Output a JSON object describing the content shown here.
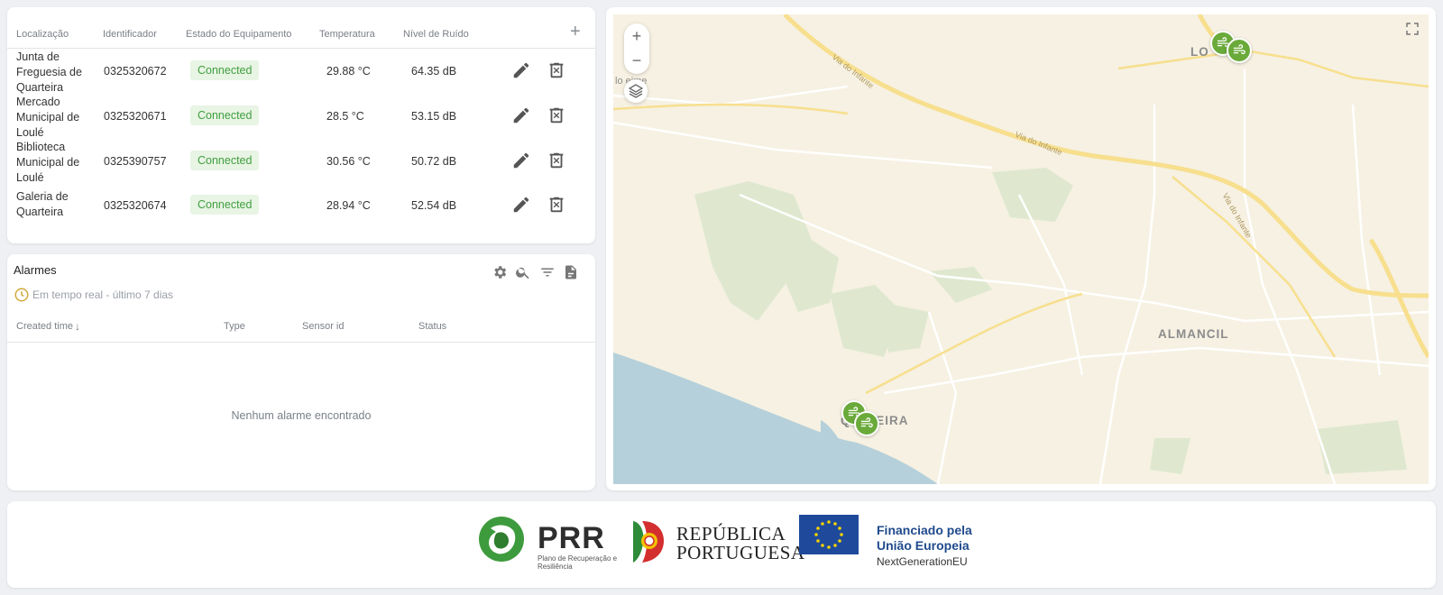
{
  "devices": {
    "columns": [
      "Localização",
      "Identificador",
      "Estado do Equipamento",
      "Temperatura",
      "Nível de Ruído"
    ],
    "add_label": "+",
    "rows": [
      {
        "location": "Junta de Freguesia de Quarteira",
        "id": "0325320672",
        "status": "Connected",
        "temperature": "29.88 °C",
        "noise": "64.35 dB"
      },
      {
        "location": "Mercado Municipal de Loulé",
        "id": "0325320671",
        "status": "Connected",
        "temperature": "28.5 °C",
        "noise": "53.15 dB"
      },
      {
        "location": "Biblioteca Municipal de Loulé",
        "id": "0325390757",
        "status": "Connected",
        "temperature": "30.56 °C",
        "noise": "50.72 dB"
      },
      {
        "location": "Galeria de Quarteira",
        "id": "0325320674",
        "status": "Connected",
        "temperature": "28.94 °C",
        "noise": "52.54 dB"
      }
    ],
    "icons": {
      "edit": "pencil-icon",
      "delete": "trash-icon"
    }
  },
  "alarms": {
    "title": "Alarmes",
    "timewindow": "Em tempo real - último 7 dias",
    "columns": [
      "Created time",
      "Type",
      "Sensor id",
      "Status"
    ],
    "empty_message": "Nenhum alarme encontrado",
    "toolbar_icons": [
      "gear-icon",
      "search-icon",
      "filter-icon",
      "export-icon"
    ]
  },
  "map": {
    "zoom_in": "+",
    "zoom_out": "−",
    "places": {
      "loule_partial": "LO",
      "almancil": "ALMANCIL",
      "quarteira_left": "Q",
      "quarteira_right": "TEIRA",
      "boliqueime_partial": "lo    eime"
    },
    "roads": {
      "via_infante_1": "Via do Infante",
      "via_infante_2": "Via do Infante",
      "via_infante_3": "Via do Infante"
    },
    "marker_color": "#6aaa3a"
  },
  "footer": {
    "prr_title": "PRR",
    "prr_subtitle": "Plano de Recuperação e Resiliência",
    "republica_line1": "REPÚBLICA",
    "republica_line2": "PORTUGUESA",
    "eu_line1": "Financiado pela",
    "eu_line2": "União Europeia",
    "eu_line3": "NextGenerationEU"
  },
  "colors": {
    "connected_text": "#3f9f3f",
    "connected_bg": "#e8f4e4",
    "eu_blue": "#1f4a8c",
    "prr_green": "#3d9b3d"
  }
}
